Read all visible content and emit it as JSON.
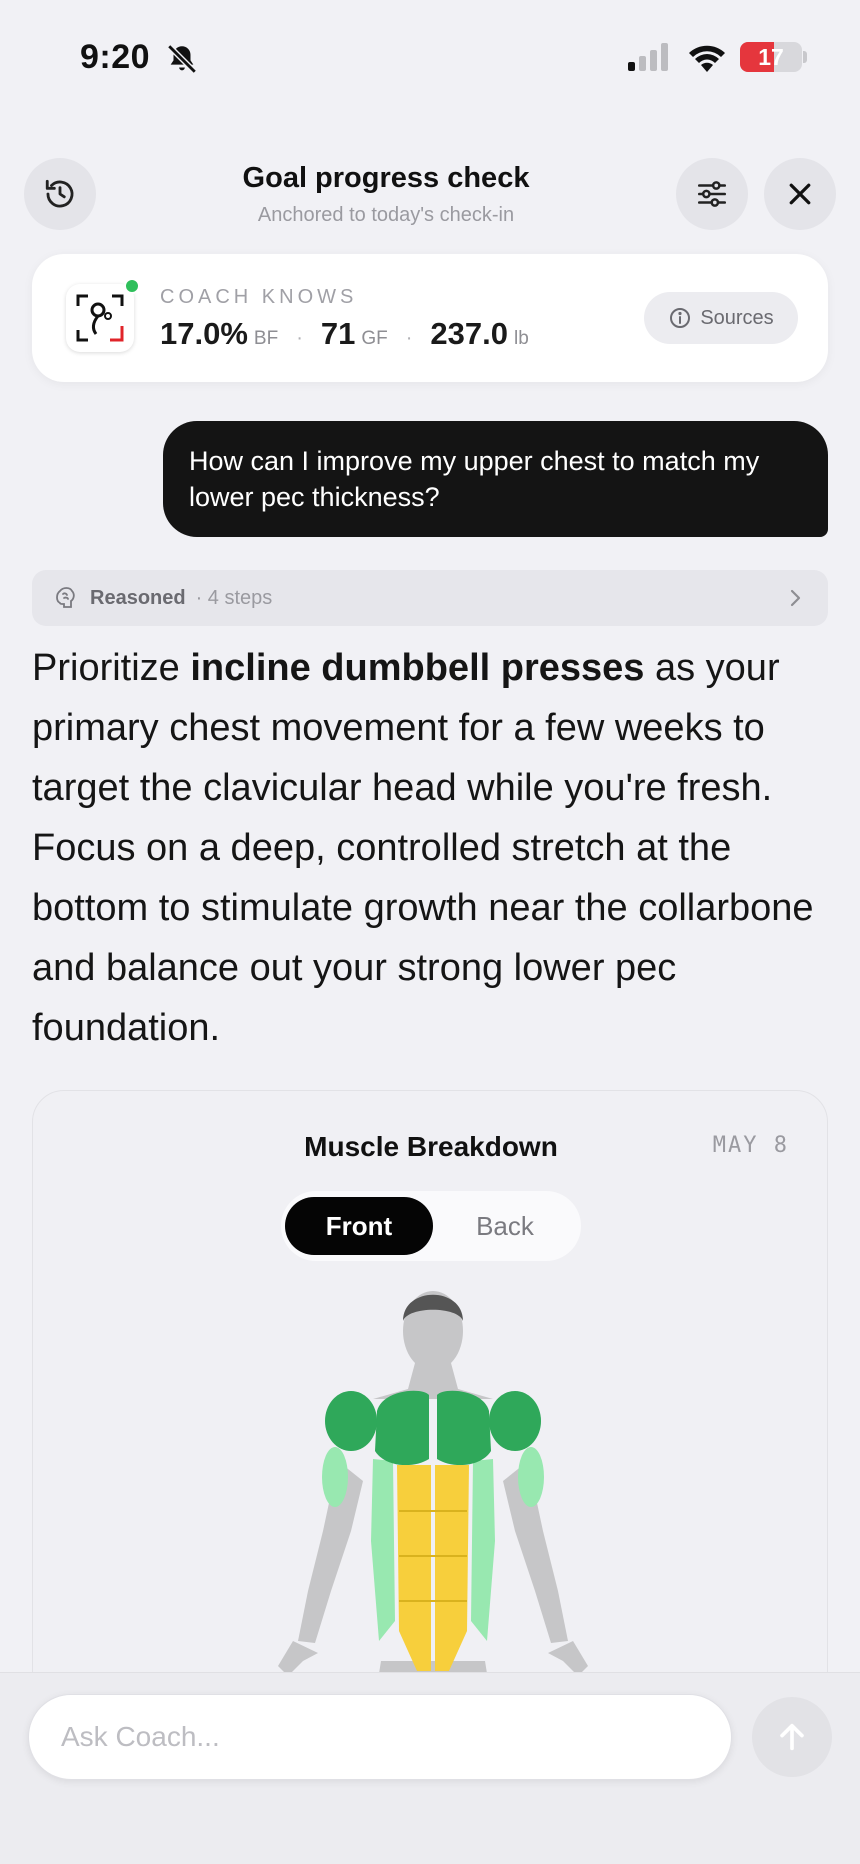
{
  "status_bar": {
    "time": "9:20",
    "battery_level": "17",
    "battery_fraction": 0.17
  },
  "header": {
    "title": "Goal progress check",
    "subtitle": "Anchored to today's check-in"
  },
  "coach_card": {
    "label": "COACH KNOWS",
    "stats": [
      {
        "value": "17.0%",
        "unit": "BF"
      },
      {
        "value": "71",
        "unit": "GF"
      },
      {
        "value": "237.0",
        "unit": "lb"
      }
    ],
    "separator": "·",
    "sources_label": "Sources"
  },
  "user_message": "How can I improve my upper chest to match my lower pec thickness?",
  "reasoning": {
    "label": "Reasoned",
    "steps": "· 4 steps"
  },
  "answer": {
    "intro": "Prioritize ",
    "bold": "incline dumbbell presses",
    "rest": " as your primary chest movement for a few weeks to target the clavicular head while you're fresh. Focus on a deep, controlled stretch at the bottom to stimulate growth near the collarbone and balance out your strong lower pec foundation."
  },
  "muscle_card": {
    "title": "Muscle Breakdown",
    "date": "MAY 8",
    "tabs": {
      "front": "Front",
      "back": "Back"
    },
    "colors": {
      "strong": "#2fa85a",
      "moderate": "#98e8b0",
      "focus": "#f7cf3c",
      "neutral": "#c6c6c8"
    }
  },
  "composer": {
    "placeholder": "Ask Coach..."
  },
  "icons": [
    "bell-slash-icon",
    "signal-icon",
    "wifi-icon",
    "battery-icon",
    "history-icon",
    "sliders-icon",
    "close-icon",
    "info-icon",
    "brain-icon",
    "chevron-right-icon",
    "arrow-up-icon"
  ]
}
